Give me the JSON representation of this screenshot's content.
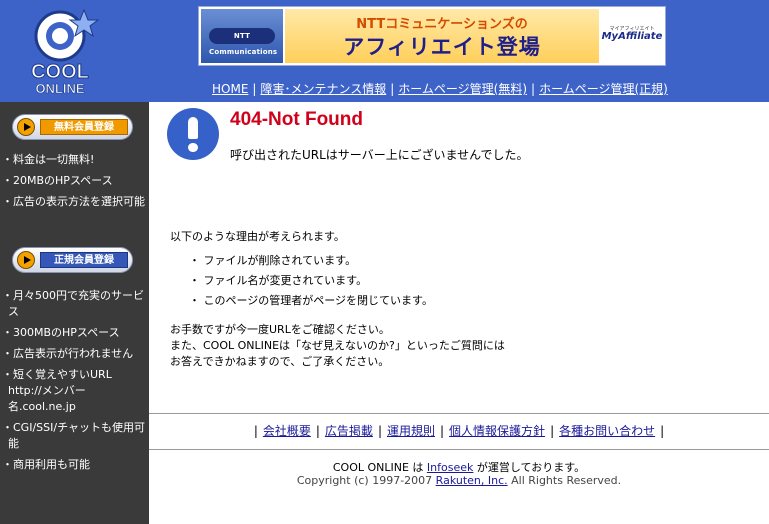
{
  "header": {
    "logo_line1": "COOL",
    "logo_line2": "ONLINE",
    "banner": {
      "ntt_label": "NTT Communications",
      "line1": "NTTコミュニケーションズの",
      "line2": "アフィリエイト登場",
      "my_small": "マイアフィリエイト",
      "my_text": "MyAffiliate"
    },
    "nav": [
      {
        "label": "HOME"
      },
      {
        "label": "障害･メンテナンス情報"
      },
      {
        "label": "ホームページ管理(無料)"
      },
      {
        "label": "ホームページ管理(正規)"
      }
    ]
  },
  "sidebar": {
    "free_button": "無料会員登録",
    "free_items": [
      "料金は一切無料!",
      "20MBのHPスペース",
      "広告の表示方法を選択可能"
    ],
    "paid_button": "正規会員登録",
    "paid_items": [
      "月々500円で充実のサービス",
      "300MBのHPスペース",
      "広告表示が行われません",
      "短く覚えやすいURL http://メンバー名.cool.ne.jp",
      "CGI/SSI/チャットも使用可能",
      "商用利用も可能"
    ]
  },
  "main": {
    "title": "404-Not Found",
    "subtitle": "呼び出されたURLはサーバー上にございませんでした。",
    "reasons_intro": "以下のような理由が考えられます。",
    "reasons": [
      "ファイルが削除されています。",
      "ファイル名が変更されています。",
      "このページの管理者がページを閉じています。"
    ],
    "confirm_lines": [
      "お手数ですが今一度URLをご確認ください。",
      "また、COOL ONLINEは「なぜ見えないのか?」といったご質問には",
      "お答えできかねますので、ご了承ください。"
    ]
  },
  "footer": {
    "links": [
      {
        "label": "会社概要"
      },
      {
        "label": "広告掲載"
      },
      {
        "label": "運用規則"
      },
      {
        "label": "個人情報保護方針"
      },
      {
        "label": "各種お問い合わせ"
      }
    ],
    "operated_prefix": "COOL ONLINE は ",
    "operated_link": "Infoseek",
    "operated_suffix": " が運営しております。",
    "copyright_prefix": "Copyright (c) 1997-2007 ",
    "copyright_link": "Rakuten, Inc.",
    "copyright_suffix": " All Rights Reserved."
  },
  "colors": {
    "header_bg": "#3d63c9",
    "sidebar_bg": "#3a3a3a",
    "error_red": "#d0021b",
    "icon_blue": "#3561c8"
  }
}
